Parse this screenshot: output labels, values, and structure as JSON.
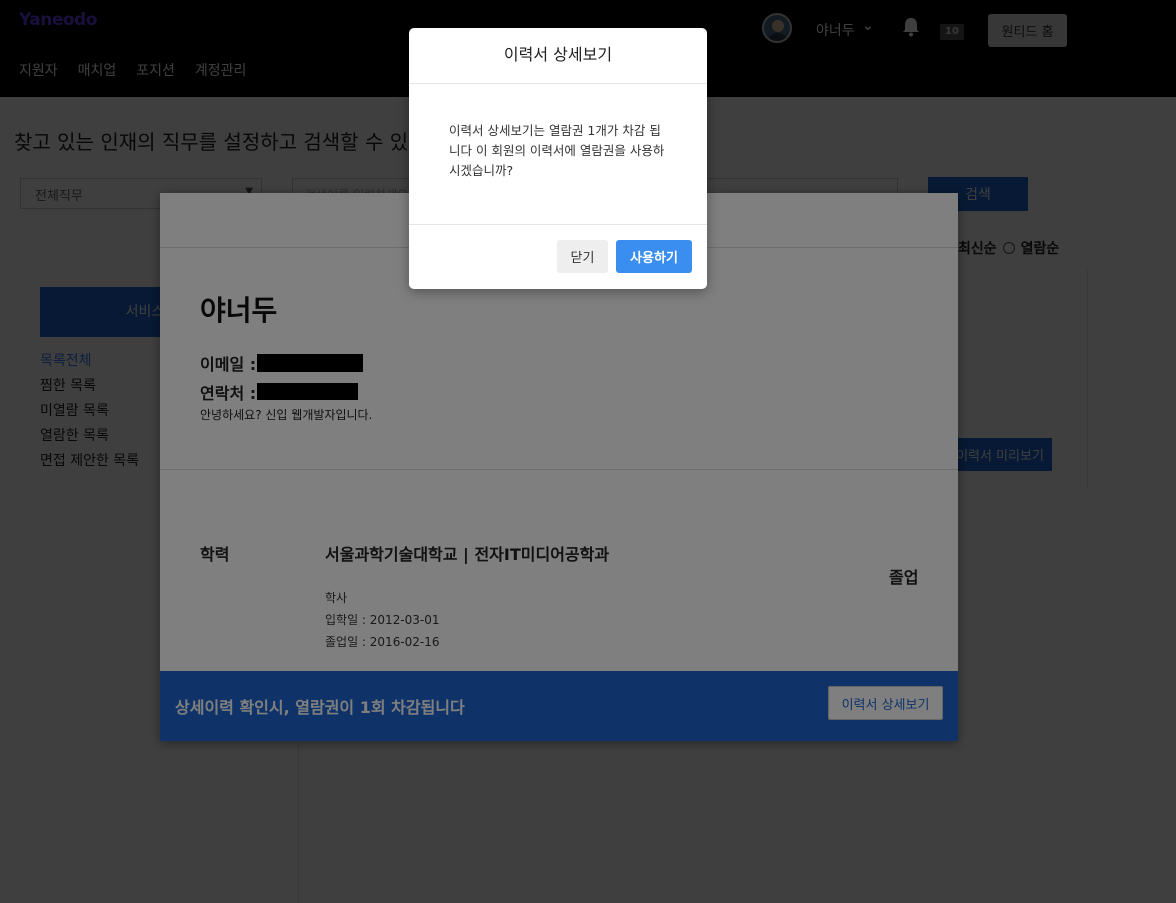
{
  "header": {
    "logo": "Yaneodo",
    "nav": [
      "지원자",
      "매치업",
      "포지션",
      "계정관리"
    ],
    "user_name": "야너두",
    "notification_count": "10",
    "home_button": "원티드 홈"
  },
  "main": {
    "page_title": "찾고 있는 인재의 직무를 설정하고 검색할 수 있습니다",
    "job_select_value": "전체직무",
    "search_placeholder": "검색어를 입력하세요",
    "search_button": "검색",
    "sort_options": [
      "최신순",
      "열람순"
    ],
    "service_button": "서비스 결제",
    "side_menu": [
      "목록전체",
      "찜한 목록",
      "미열람 목록",
      "열람한 목록",
      "면접 제안한 목록"
    ],
    "preview_button": "이력서 미리보기"
  },
  "resume_modal": {
    "name": "야너두",
    "email_label": "이메일 :",
    "phone_label": "연락처 :",
    "intro": "안녕하세요? 신입 웹개발자입니다.",
    "education_label": "학력",
    "school": "서울과학기술대학교 | 전자IT미디어공학과",
    "graduation_status": "졸업",
    "degree": "학사",
    "start_date": "입학일 : 2012-03-01",
    "end_date": "졸업일 : 2016-02-16",
    "footer_notice": "상세이력 확인시, 열람권이 1회 차감됩니다",
    "detail_button": "이력서 상세보기"
  },
  "confirm_dialog": {
    "title": "이력서 상세보기",
    "message": "이력서 상세보기는 열람권 1개가 차감 됩니다 이 회원의 이력서에 열람권을 사용하시겠습니까?",
    "close_button": "닫기",
    "use_button": "사용하기"
  }
}
